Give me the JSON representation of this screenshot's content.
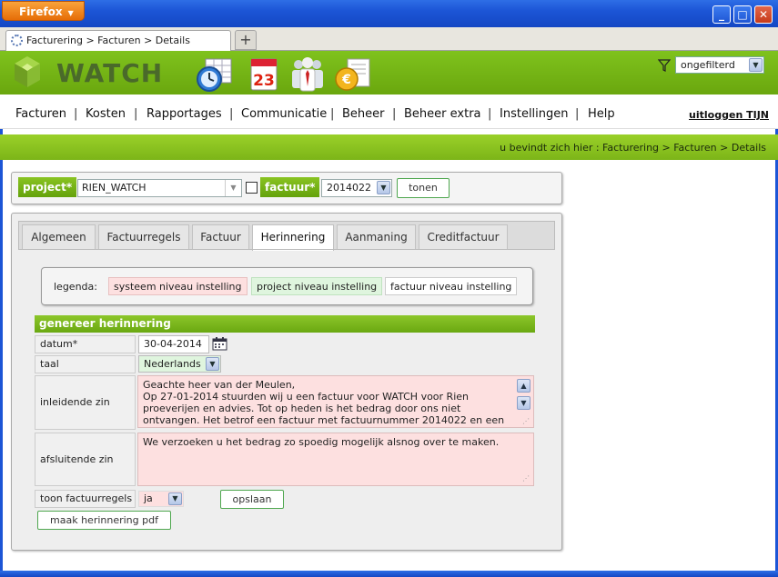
{
  "browser": {
    "app_button": "Firefox",
    "tab_title": "Facturering > Facturen > Details",
    "new_tab": "+"
  },
  "app": {
    "logo_text": "WATCH",
    "calendar_day": "23",
    "filter_value": "ongefilterd"
  },
  "menu": {
    "items": [
      "Facturen",
      "Kosten",
      "Rapportages",
      "Communicatie",
      "Beheer",
      "Beheer extra",
      "Instellingen",
      "Help"
    ],
    "logout": "uitloggen TIJN"
  },
  "breadcrumb": "u bevindt zich hier : Facturering > Facturen > Details",
  "selector": {
    "project_label": "project*",
    "project_value": "RIEN_WATCH",
    "factuur_label": "factuur*",
    "factuur_value": "2014022",
    "show_button": "tonen"
  },
  "tabs": [
    "Algemeen",
    "Factuurregels",
    "Factuur",
    "Herinnering",
    "Aanmaning",
    "Creditfactuur"
  ],
  "active_tab": "Herinnering",
  "legend": {
    "label": "legenda:",
    "system": "systeem niveau instelling",
    "project": "project niveau instelling",
    "invoice": "factuur niveau instelling"
  },
  "form": {
    "section_title": "genereer herinnering",
    "date_label": "datum*",
    "date_value": "30-04-2014",
    "lang_label": "taal",
    "lang_value": "Nederlands",
    "intro_label": "inleidende zin",
    "intro_lines": [
      "Geachte heer van der Meulen,",
      "Op 27-01-2014 stuurden wij u een factuur voor WATCH voor Rien",
      "proeverijen en advies. Tot op heden is het bedrag door ons niet",
      "ontvangen. Het betrof een factuur met factuurnummer 2014022 en een"
    ],
    "closing_label": "afsluitende zin",
    "closing_text": "We verzoeken u het bedrag zo spoedig mogelijk alsnog over te maken.",
    "show_lines_label": "toon factuurregels",
    "show_lines_value": "ja",
    "save_button": "opslaan",
    "pdf_button": "maak herinnering pdf"
  },
  "colors": {
    "accent_green": "#7cb518",
    "system_pink": "#fde0e0",
    "project_green": "#dff5de",
    "titlebar_blue": "#1c55d6"
  }
}
